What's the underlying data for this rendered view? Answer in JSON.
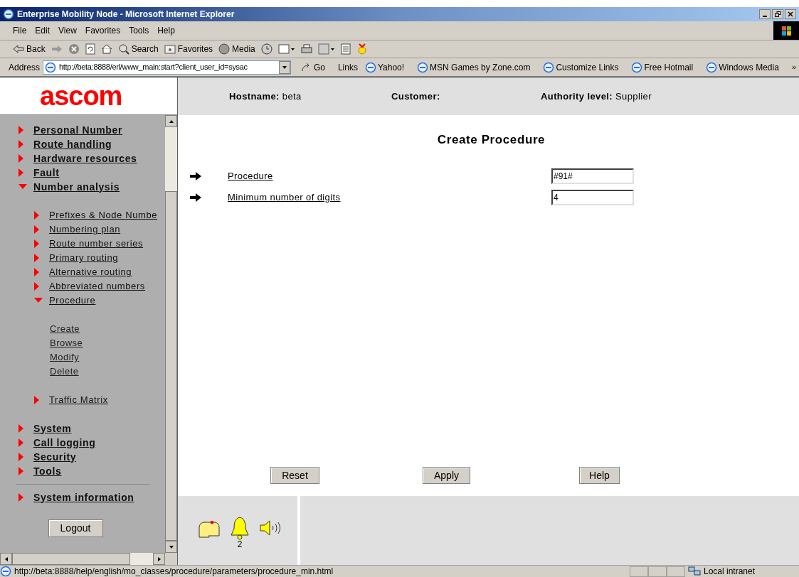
{
  "window": {
    "title": "Enterprise Mobility Node - Microsoft Internet Explorer"
  },
  "menu": [
    "File",
    "Edit",
    "View",
    "Favorites",
    "Tools",
    "Help"
  ],
  "toolbar": [
    {
      "kind": "back",
      "label": "Back"
    },
    {
      "kind": "forward"
    },
    {
      "kind": "stop"
    },
    {
      "kind": "refresh"
    },
    {
      "kind": "home"
    },
    {
      "kind": "search",
      "label": "Search"
    },
    {
      "kind": "favorites",
      "label": "Favorites"
    },
    {
      "kind": "media",
      "label": "Media"
    },
    {
      "kind": "history"
    },
    {
      "kind": "mail"
    },
    {
      "kind": "print"
    },
    {
      "kind": "edit"
    },
    {
      "kind": "discuss"
    },
    {
      "kind": "messenger"
    }
  ],
  "address": {
    "label": "Address",
    "value": "http://beta:8888/erl/www_main:start?client_user_id=sysac",
    "go": "Go"
  },
  "links": {
    "label": "Links",
    "items": [
      "Yahoo!",
      "MSN Games by Zone.com",
      "Customize Links",
      "Free Hotmail",
      "Windows Media"
    ],
    "more": "»"
  },
  "logo": "ascom",
  "header": [
    {
      "label": "Hostname:",
      "value": "beta"
    },
    {
      "label": "Customer:"
    },
    {
      "label": "Authority level:",
      "value": "Supplier"
    }
  ],
  "nav": [
    {
      "label": "Personal Number",
      "kind": "folder",
      "expanded": false
    },
    {
      "label": "Route handling",
      "kind": "folder",
      "expanded": false
    },
    {
      "label": "Hardware resources",
      "kind": "folder",
      "expanded": false
    },
    {
      "label": "Fault",
      "kind": "folder",
      "expanded": false
    },
    {
      "label": "Number analysis",
      "kind": "folder",
      "expanded": true,
      "children": [
        {
          "label": "Prefixes & Node Numbe",
          "kind": "folder",
          "expanded": false
        },
        {
          "label": "Numbering plan",
          "kind": "folder",
          "expanded": false
        },
        {
          "label": "Route number series",
          "kind": "folder",
          "expanded": false
        },
        {
          "label": "Primary routing",
          "kind": "folder",
          "expanded": false
        },
        {
          "label": "Alternative routing",
          "kind": "folder",
          "expanded": false
        },
        {
          "label": "Abbreviated numbers",
          "kind": "folder",
          "expanded": false
        },
        {
          "label": "Procedure",
          "kind": "folder",
          "expanded": true,
          "children": [
            {
              "label": "Create",
              "kind": "action"
            },
            {
              "label": "Browse",
              "kind": "action"
            },
            {
              "label": "Modify",
              "kind": "action"
            },
            {
              "label": "Delete",
              "kind": "action"
            }
          ]
        },
        {
          "label": "Traffic Matrix",
          "kind": "folder",
          "expanded": false
        }
      ]
    },
    {
      "label": "System",
      "kind": "folder",
      "expanded": false
    },
    {
      "label": "Call logging",
      "kind": "folder",
      "expanded": false
    },
    {
      "label": "Security",
      "kind": "folder",
      "expanded": false
    },
    {
      "label": "Tools",
      "kind": "folder",
      "expanded": false
    }
  ],
  "nav_footer": {
    "label": "System information",
    "expanded": false
  },
  "logout": "Logout",
  "page_title": "Create Procedure",
  "fields": [
    {
      "label": "Procedure",
      "value": "#91#"
    },
    {
      "label": "Minimum number of digits",
      "value": "4"
    }
  ],
  "buttons": [
    "Reset",
    "Apply",
    "Help"
  ],
  "alarm_count": "2",
  "status": {
    "url": "http://beta:8888/help/english/mo_classes/procedure/parameters/procedure_min.html",
    "zone": "Local intranet"
  }
}
